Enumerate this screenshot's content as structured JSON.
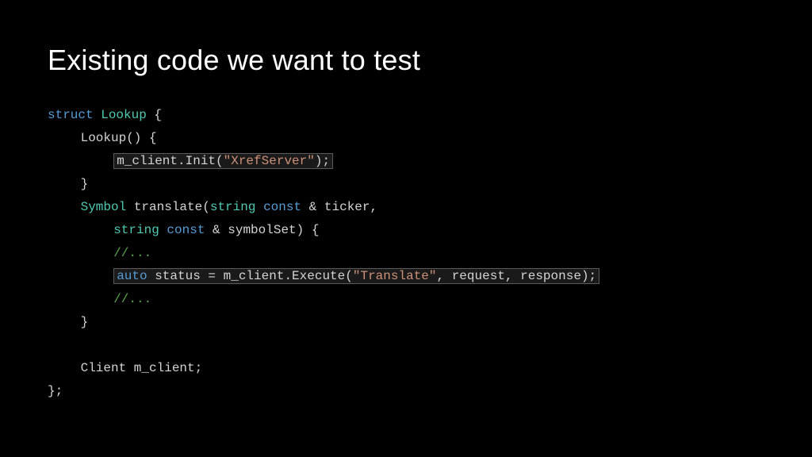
{
  "title": "Existing code we want to test",
  "code": {
    "l1_struct": "struct",
    "l1_name": "Lookup",
    "l1_brace": " {",
    "l2_ctor": "Lookup",
    "l2_parens": "() {",
    "l3_member": "m_client",
    "l3_dot": ".",
    "l3_func": "Init",
    "l3_open": "(",
    "l3_str": "\"XrefServer\"",
    "l3_close": ");",
    "l4_brace": "}",
    "l5_ret": "Symbol",
    "l5_func": "translate",
    "l5_open": "(",
    "l5_strtype": "string",
    "l5_const": "const",
    "l5_amp": " & ",
    "l5_param1": "ticker",
    "l5_comma": ",",
    "l6_strtype": "string",
    "l6_const": "const",
    "l6_amp": " & ",
    "l6_param2": "symbolSet",
    "l6_close": ") {",
    "l7_comment": "//...",
    "l8_auto": "auto",
    "l8_sp1": " ",
    "l8_status": "status",
    "l8_eq": " = ",
    "l8_member": "m_client",
    "l8_dot": ".",
    "l8_func": "Execute",
    "l8_open": "(",
    "l8_str": "\"Translate\"",
    "l8_c1": ", ",
    "l8_req": "request",
    "l8_c2": ", ",
    "l8_resp": "response",
    "l8_close": ");",
    "l9_comment": "//...",
    "l10_brace": "}",
    "l11_blank": "",
    "l12_type": "Client",
    "l12_name": " m_client",
    "l12_semi": ";",
    "l13_end": "};"
  }
}
